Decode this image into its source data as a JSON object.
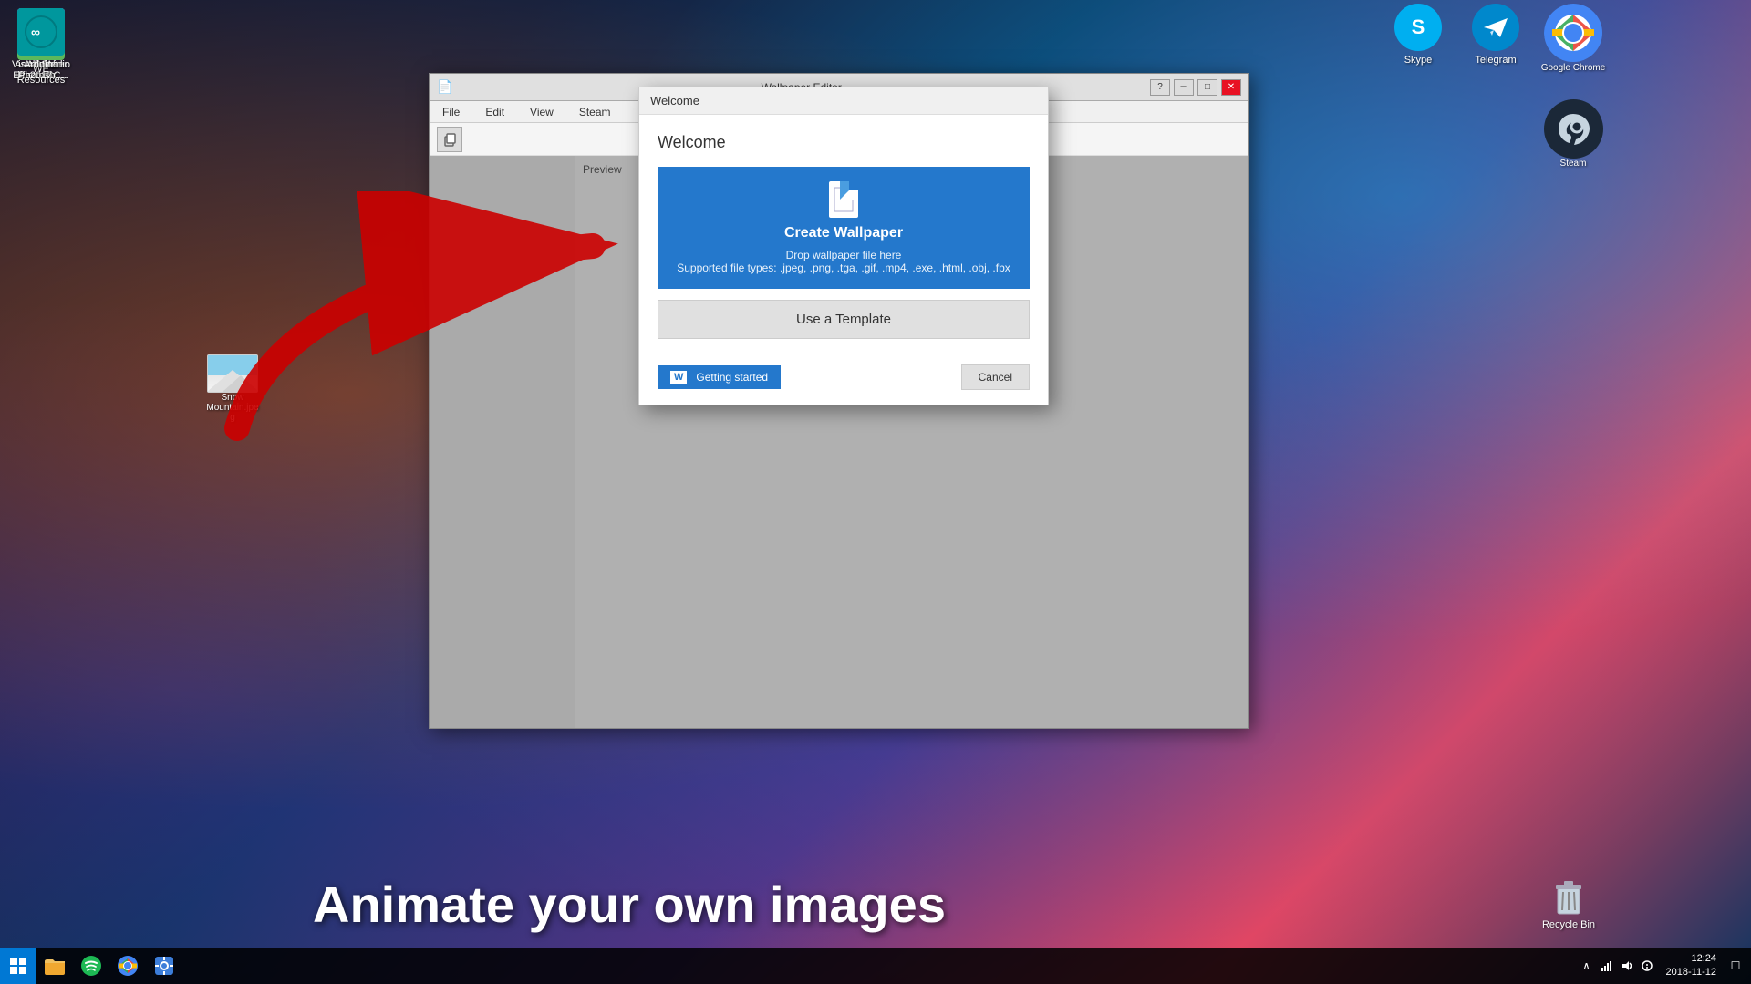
{
  "window": {
    "title": "Wallpaper Editor",
    "menubar": [
      "File",
      "Edit",
      "View",
      "Steam"
    ],
    "preview_label": "Preview"
  },
  "dialog": {
    "title": "Welcome",
    "create_wallpaper_label": "Create Wallpaper",
    "drop_text": "Drop wallpaper file here",
    "supported_types": "Supported file types: .jpeg, .png, .tga, .gif, .mp4, .exe, .html, .obj, .fbx",
    "use_template_label": "Use a Template",
    "getting_started_label": "Getting started",
    "cancel_label": "Cancel"
  },
  "desktop": {
    "icons": [
      {
        "id": "pc",
        "label": "PC",
        "color": "#4a90d9"
      },
      {
        "id": "adobe-illustrator",
        "label": "Adobe Illustrator ...",
        "color": "#ff9a00"
      },
      {
        "id": "adobe-after-effects",
        "label": "Adobe After Effects CC...",
        "color": "#9999ff"
      },
      {
        "id": "adobe-photoshop",
        "label": "Adobe Photosh...",
        "color": "#31a8ff"
      },
      {
        "id": "visual-studio",
        "label": "Visual Studio 2017",
        "color": "#5c2d91"
      },
      {
        "id": "we-resources",
        "label": "WE Resources",
        "color": "#5cb85c"
      },
      {
        "id": "arduino",
        "label": "Arduino",
        "color": "#00979d"
      }
    ],
    "top_right": [
      {
        "id": "skype",
        "label": "Skype",
        "color": "#00aff0"
      },
      {
        "id": "telegram",
        "label": "Telegram",
        "color": "#0088cc"
      },
      {
        "id": "google-chrome",
        "label": "Google Chrome",
        "color": "#4285f4"
      },
      {
        "id": "steam",
        "label": "Steam",
        "color": "#1b2838"
      }
    ],
    "snow_file": {
      "label": "Snow Mountain.jpeg"
    }
  },
  "taskbar": {
    "start_label": "⊞",
    "pinned": [
      "🗂",
      "♪",
      "🌐",
      "👤"
    ],
    "clock": "12:24",
    "date": "2018-11-12"
  },
  "bottom_text": "Animate your own images",
  "colors": {
    "create_btn_bg": "#2478cc",
    "use_template_bg": "#e0e0e0",
    "getting_started_bg": "#2478cc"
  }
}
